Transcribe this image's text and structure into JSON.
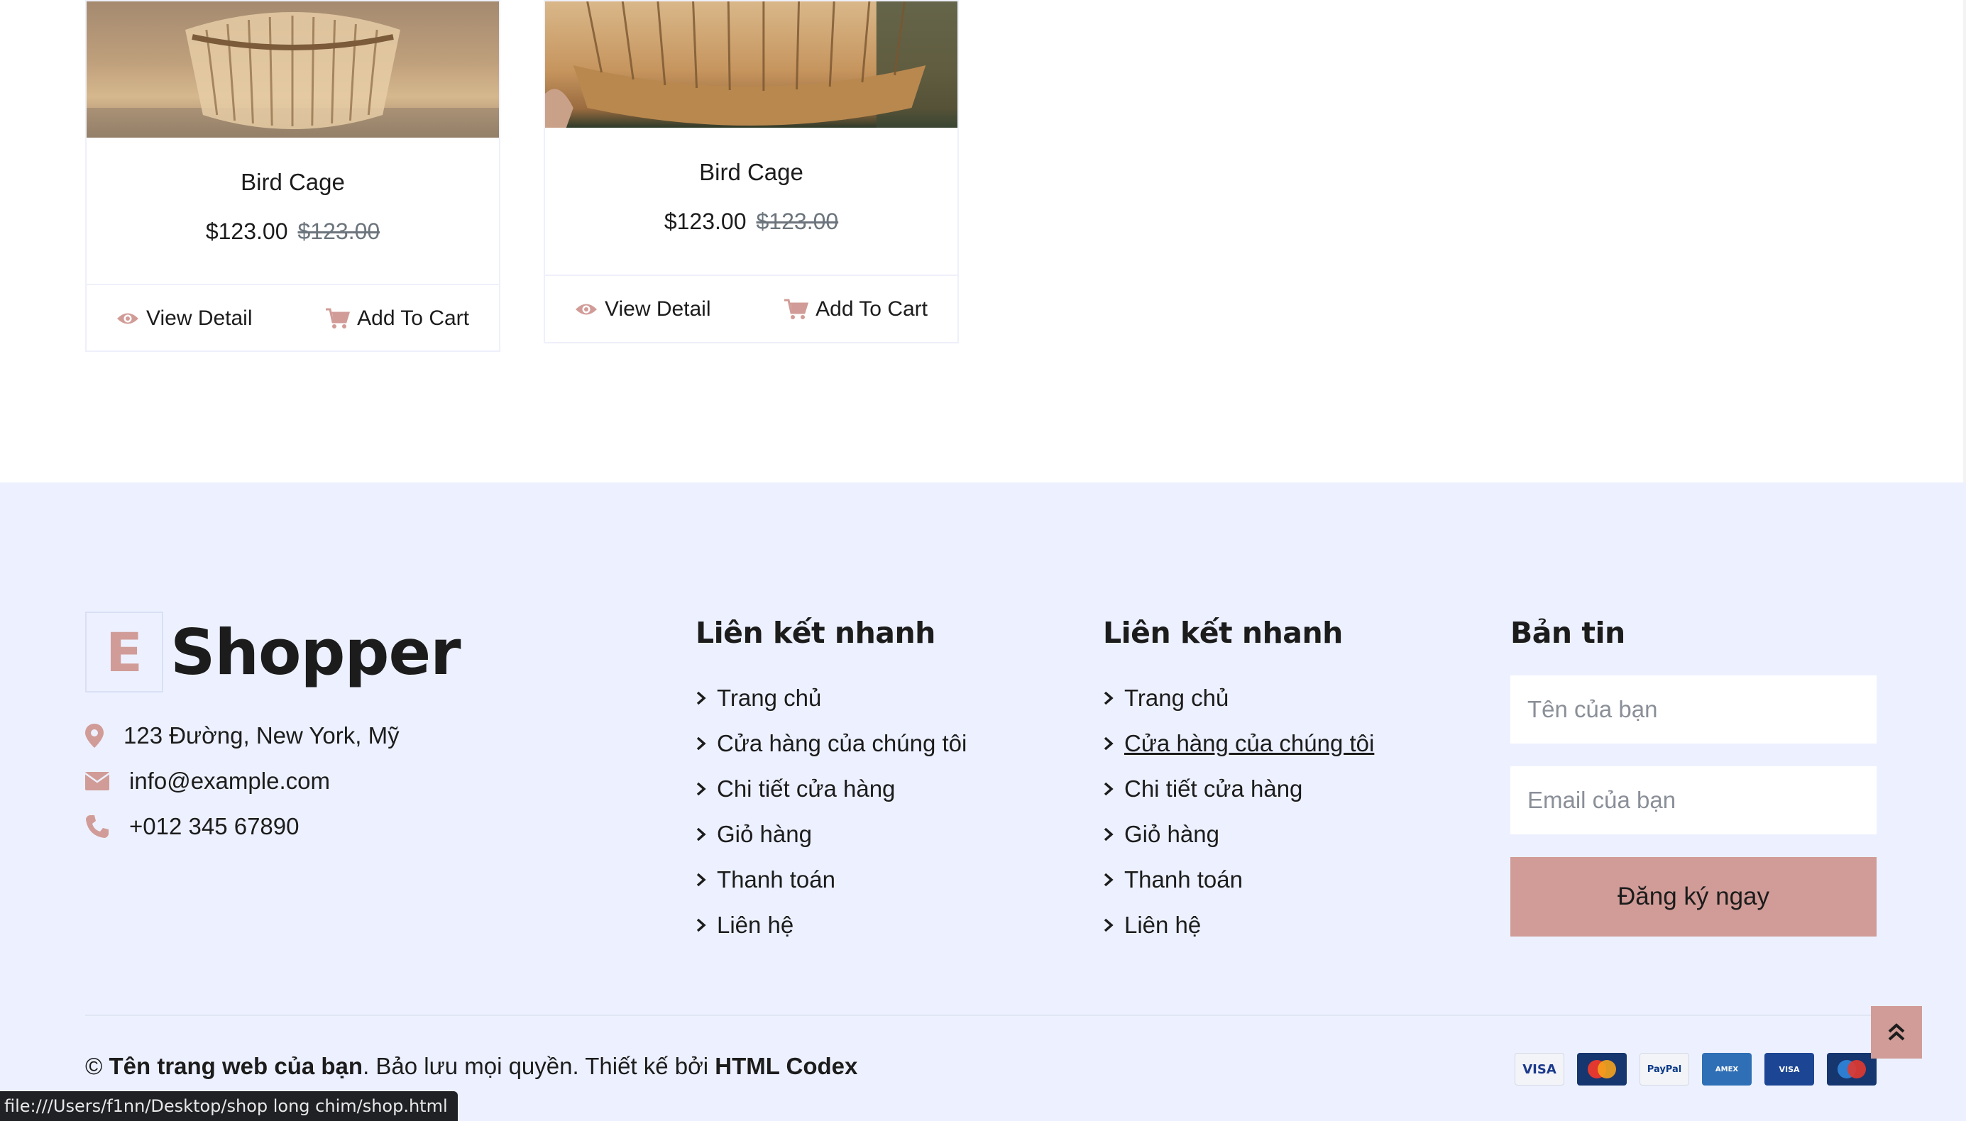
{
  "products": [
    {
      "name": "Bird Cage",
      "price": "$123.00",
      "old_price": "$123.00",
      "view_label": "View Detail",
      "cart_label": "Add To Cart"
    },
    {
      "name": "Bird Cage",
      "price": "$123.00",
      "old_price": "$123.00",
      "view_label": "View Detail",
      "cart_label": "Add To Cart"
    }
  ],
  "footer": {
    "logo_letter": "E",
    "logo_text": "Shopper",
    "address": "123 Đường, New York, Mỹ",
    "email": "info@example.com",
    "phone": "+012 345 67890",
    "quick_links_1": {
      "title": "Liên kết nhanh",
      "items": [
        "Trang chủ",
        "Cửa hàng của chúng tôi",
        "Chi tiết cửa hàng",
        "Giỏ hàng",
        "Thanh toán",
        "Liên hệ"
      ]
    },
    "quick_links_2": {
      "title": "Liên kết nhanh",
      "items": [
        "Trang chủ",
        "Cửa hàng của chúng tôi",
        "Chi tiết cửa hàng",
        "Giỏ hàng",
        "Thanh toán",
        "Liên hệ"
      ]
    },
    "newsletter": {
      "title": "Bản tin",
      "name_placeholder": "Tên của bạn",
      "email_placeholder": "Email của bạn",
      "button_label": "Đăng ký ngay"
    },
    "copyright": {
      "symbol": "©",
      "site_name": "Tên trang web của bạn",
      "rights": ". Bảo lưu mọi quyền. Thiết kế bởi ",
      "designer": "HTML Codex"
    },
    "payments": [
      "VISA",
      "MasterCard",
      "PayPal",
      "AMERICAN EXPRESS",
      "VISA Electron",
      "Maestro"
    ]
  },
  "status_bar": "file:///Users/f1nn/Desktop/shop long chim/shop.html",
  "colors": {
    "accent": "#d19c97",
    "footer_bg": "#edf1ff",
    "text": "#1c1c1c",
    "muted": "#6c757d"
  },
  "icons": {
    "view": "eye-icon",
    "cart": "cart-icon",
    "address": "map-marker-icon",
    "email": "envelope-icon",
    "phone": "phone-icon",
    "link": "chevron-right-icon",
    "back_to_top": "double-chevron-up-icon"
  }
}
